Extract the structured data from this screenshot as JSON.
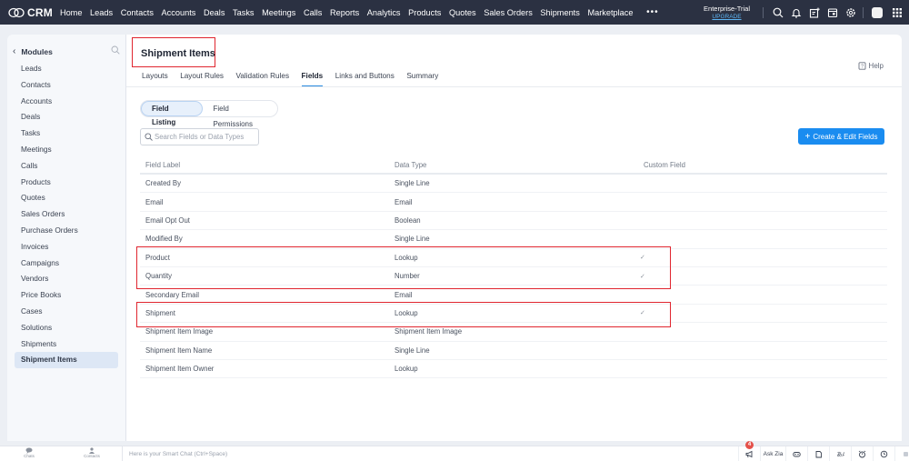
{
  "topbar": {
    "brand": "CRM",
    "nav": [
      "Home",
      "Leads",
      "Contacts",
      "Accounts",
      "Deals",
      "Tasks",
      "Meetings",
      "Calls",
      "Reports",
      "Analytics",
      "Products",
      "Quotes",
      "Sales Orders",
      "Shipments",
      "Marketplace"
    ],
    "more": "•••",
    "edition": "Enterprise-Trial",
    "upgrade": "UPGRADE"
  },
  "sidebar": {
    "title": "Modules",
    "back": "‹",
    "items": [
      "Leads",
      "Contacts",
      "Accounts",
      "Deals",
      "Tasks",
      "Meetings",
      "Calls",
      "Products",
      "Quotes",
      "Sales Orders",
      "Purchase Orders",
      "Invoices",
      "Campaigns",
      "Vendors",
      "Price Books",
      "Cases",
      "Solutions",
      "Shipments",
      "Shipment Items"
    ],
    "active": "Shipment Items"
  },
  "main": {
    "title": "Shipment Items",
    "help": "Help",
    "tabs": [
      "Layouts",
      "Layout Rules",
      "Validation Rules",
      "Fields",
      "Links and Buttons",
      "Summary"
    ],
    "active_tab": "Fields",
    "segments": [
      "Field Listing",
      "Field Permissions"
    ],
    "active_segment": "Field Listing",
    "search_placeholder": "Search Fields or Data Types",
    "create_button": "Create & Edit Fields",
    "create_plus": "+",
    "table": {
      "columns": [
        "Field Label",
        "Data Type",
        "Custom Field"
      ],
      "rows": [
        {
          "label": "Created By",
          "type": "Single Line",
          "custom": ""
        },
        {
          "label": "Email",
          "type": "Email",
          "custom": ""
        },
        {
          "label": "Email Opt Out",
          "type": "Boolean",
          "custom": ""
        },
        {
          "label": "Modified By",
          "type": "Single Line",
          "custom": ""
        },
        {
          "label": "Product",
          "type": "Lookup",
          "custom": "✓"
        },
        {
          "label": "Quantity",
          "type": "Number",
          "custom": "✓"
        },
        {
          "label": "Secondary Email",
          "type": "Email",
          "custom": ""
        },
        {
          "label": "Shipment",
          "type": "Lookup",
          "custom": "✓"
        },
        {
          "label": "Shipment Item Image",
          "type": "Shipment Item Image",
          "custom": ""
        },
        {
          "label": "Shipment Item Name",
          "type": "Single Line",
          "custom": ""
        },
        {
          "label": "Shipment Item Owner",
          "type": "Lookup",
          "custom": ""
        }
      ]
    }
  },
  "bottombar": {
    "chats": "Chats",
    "contacts": "Contacts",
    "smart_chat": "Here is your Smart Chat (Ctrl+Space)",
    "ask_zia": "Ask Zia",
    "notification_count": "4"
  },
  "colors": {
    "topbar": "#2b3142",
    "accent": "#1a8cf0",
    "highlight": "#e0252f",
    "upgrade": "#5eb6f5"
  }
}
